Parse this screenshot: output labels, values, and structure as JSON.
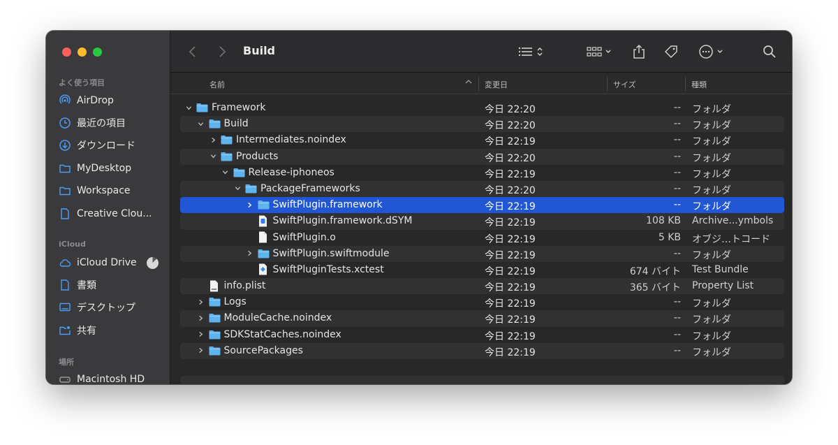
{
  "window": {
    "title": "Build"
  },
  "sidebar": {
    "favorites_header": "よく使う項目",
    "icloud_header": "iCloud",
    "locations_header": "場所",
    "items": [
      {
        "label": "AirDrop",
        "icon": "airdrop-icon"
      },
      {
        "label": "最近の項目",
        "icon": "clock-icon"
      },
      {
        "label": "ダウンロード",
        "icon": "download-icon"
      },
      {
        "label": "MyDesktop",
        "icon": "folder-icon"
      },
      {
        "label": "Workspace",
        "icon": "folder-icon"
      },
      {
        "label": "Creative Clou...",
        "icon": "document-icon"
      },
      {
        "label": "iCloud Drive",
        "icon": "cloud-icon"
      },
      {
        "label": "書類",
        "icon": "document-icon"
      },
      {
        "label": "デスクトップ",
        "icon": "desktop-icon"
      },
      {
        "label": "共有",
        "icon": "shared-folder-icon"
      },
      {
        "label": "Macintosh HD",
        "icon": "disk-icon"
      }
    ]
  },
  "columns": {
    "name": "名前",
    "date": "変更日",
    "size": "サイズ",
    "kind": "種類"
  },
  "rows": [
    {
      "name": "Framework",
      "date": "今日 22:20",
      "size": "--",
      "kind": "フォルダ"
    },
    {
      "name": "Build",
      "date": "今日 22:20",
      "size": "--",
      "kind": "フォルダ"
    },
    {
      "name": "Intermediates.noindex",
      "date": "今日 22:19",
      "size": "--",
      "kind": "フォルダ"
    },
    {
      "name": "Products",
      "date": "今日 22:20",
      "size": "--",
      "kind": "フォルダ"
    },
    {
      "name": "Release-iphoneos",
      "date": "今日 22:19",
      "size": "--",
      "kind": "フォルダ"
    },
    {
      "name": "PackageFrameworks",
      "date": "今日 22:20",
      "size": "--",
      "kind": "フォルダ"
    },
    {
      "name": "SwiftPlugin.framework",
      "date": "今日 22:19",
      "size": "--",
      "kind": "フォルダ"
    },
    {
      "name": "SwiftPlugin.framework.dSYM",
      "date": "今日 22:19",
      "size": "108 KB",
      "kind": "Archive...ymbols"
    },
    {
      "name": "SwiftPlugin.o",
      "date": "今日 22:19",
      "size": "5 KB",
      "kind": "オブジ…トコード"
    },
    {
      "name": "SwiftPlugin.swiftmodule",
      "date": "今日 22:19",
      "size": "--",
      "kind": "フォルダ"
    },
    {
      "name": "SwiftPluginTests.xctest",
      "date": "今日 22:19",
      "size": "674 バイト",
      "kind": "Test Bundle"
    },
    {
      "name": "info.plist",
      "date": "今日 22:19",
      "size": "365 バイト",
      "kind": "Property List"
    },
    {
      "name": "Logs",
      "date": "今日 22:19",
      "size": "--",
      "kind": "フォルダ"
    },
    {
      "name": "ModuleCache.noindex",
      "date": "今日 22:19",
      "size": "--",
      "kind": "フォルダ"
    },
    {
      "name": "SDKStatCaches.noindex",
      "date": "今日 22:19",
      "size": "--",
      "kind": "フォルダ"
    },
    {
      "name": "SourcePackages",
      "date": "今日 22:19",
      "size": "--",
      "kind": "フォルダ"
    }
  ],
  "colors": {
    "selection": "#2157d4",
    "folder": "#5fb4f0",
    "sidebar_icon": "#4a9df5"
  }
}
